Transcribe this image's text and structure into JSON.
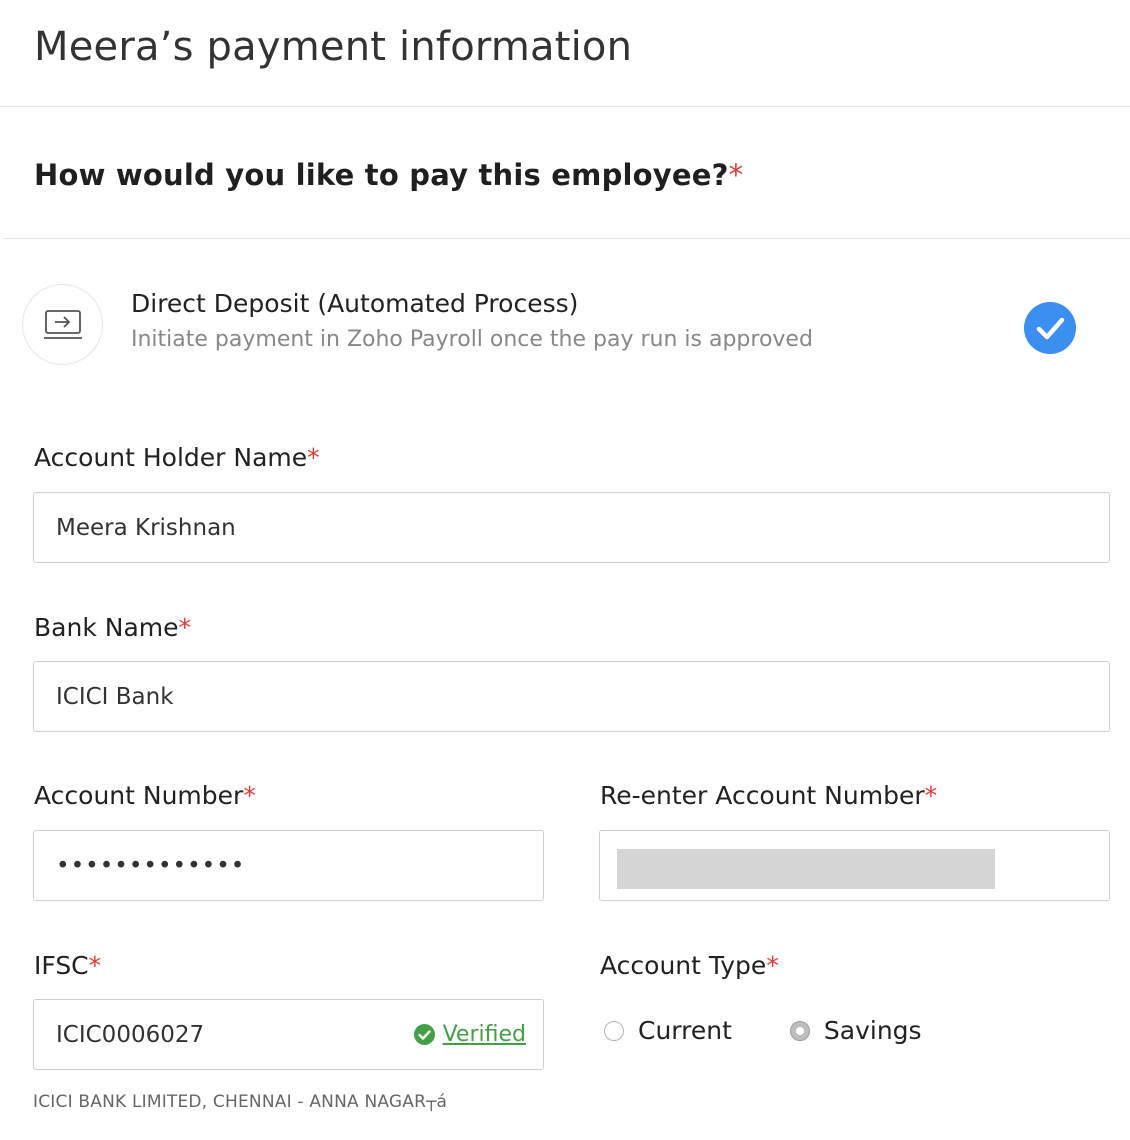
{
  "header": {
    "title": "Meera’s payment information"
  },
  "question": {
    "text": "How would you like to pay this employee?",
    "required": "*"
  },
  "payment_option": {
    "title": "Direct Deposit (Automated Process)",
    "description": "Initiate payment in Zoho Payroll once the pay run is approved",
    "icon": "transfer-screen-icon",
    "selected_icon": "checkmark-circle-icon",
    "accent_color": "#3a8ff0"
  },
  "form": {
    "account_holder": {
      "label": "Account Holder Name",
      "value": "Meera Krishnan"
    },
    "bank_name": {
      "label": "Bank Name",
      "value": "ICICI Bank"
    },
    "account_number": {
      "label": "Account Number",
      "value": "•••••••••••••"
    },
    "reenter_account_number": {
      "label": "Re-enter Account Number",
      "value": ""
    },
    "ifsc": {
      "label": "IFSC",
      "value": "ICIC0006027",
      "status": "Verified",
      "status_color": "#43a047"
    },
    "account_type": {
      "label": "Account Type",
      "options": [
        "Current",
        "Savings"
      ],
      "selected": "Savings"
    },
    "bank_branch_note": "ICICI BANK LIMITED, CHENNAI - ANNA NAGAR┬á",
    "required_mark": "*"
  }
}
